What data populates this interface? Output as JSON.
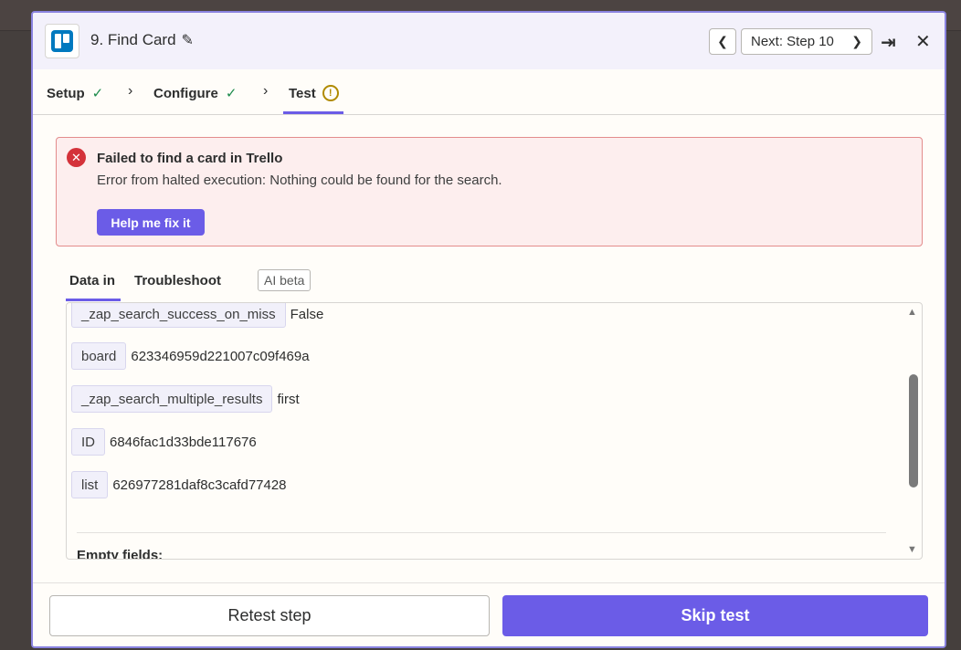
{
  "header": {
    "title": "9. Find Card",
    "next_label": "Next: Step 10",
    "app_icon": "trello-icon"
  },
  "tabs": [
    {
      "label": "Setup",
      "status": "complete"
    },
    {
      "label": "Configure",
      "status": "complete"
    },
    {
      "label": "Test",
      "status": "warning"
    }
  ],
  "error": {
    "title": "Failed to find a card in Trello",
    "message": "Error from halted execution: Nothing could be found for the search.",
    "fix_label": "Help me fix it"
  },
  "subtabs": {
    "data_in": "Data in",
    "troubleshoot": "Troubleshoot",
    "beta": "AI beta"
  },
  "fields": [
    {
      "key": "_zap_search_success_on_miss",
      "value": "False"
    },
    {
      "key": "board",
      "value": "623346959d221007c09f469a"
    },
    {
      "key": "_zap_search_multiple_results",
      "value": "first"
    },
    {
      "key": "ID",
      "value": "6846fac1d33bde117676"
    },
    {
      "key": "list",
      "value": "626977281daf8c3cafd77428"
    }
  ],
  "empty_fields_label": "Empty fields:",
  "footer": {
    "retest_label": "Retest step",
    "skip_label": "Skip test"
  },
  "colors": {
    "accent": "#6b5ce7",
    "error": "#d4323a",
    "success": "#1b8a4a"
  }
}
